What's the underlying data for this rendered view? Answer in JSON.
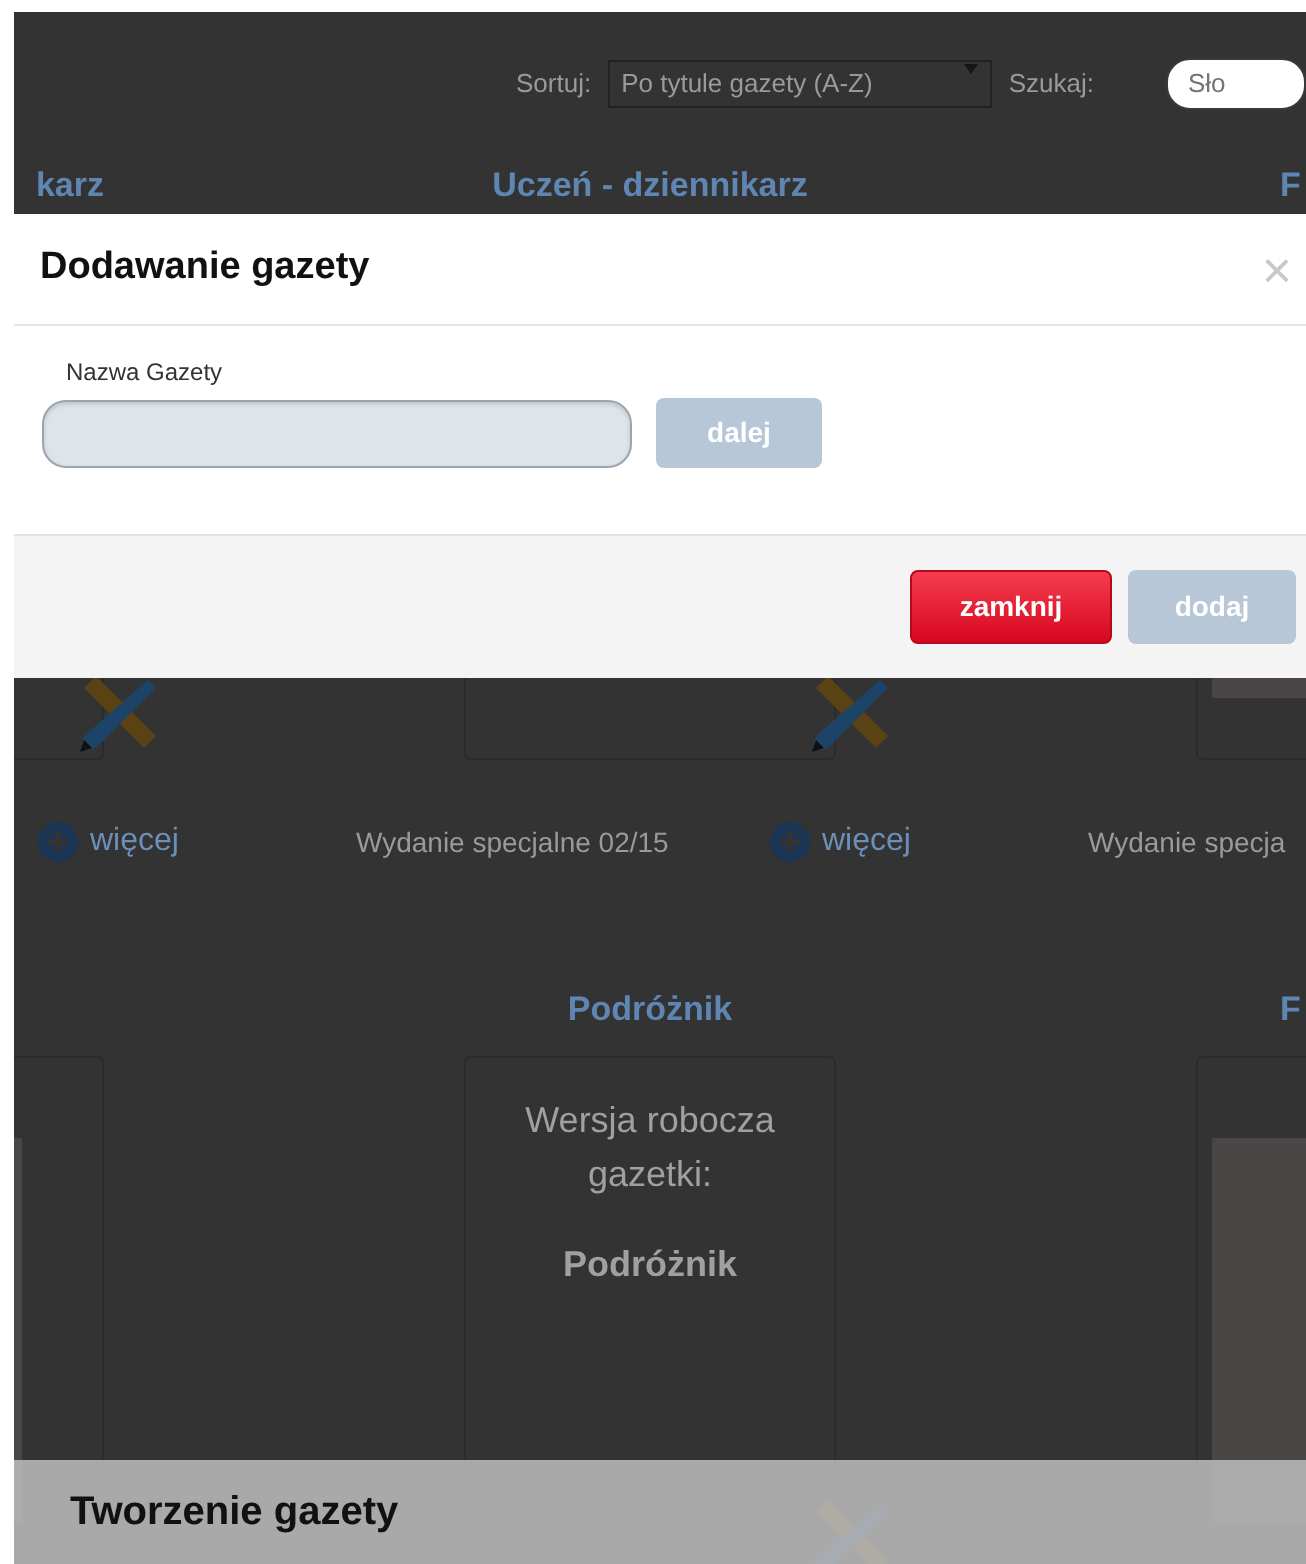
{
  "toolbar": {
    "sort_label": "Sortuj:",
    "sort_value": "Po tytule gazety (A-Z)",
    "search_label": "Szukaj:",
    "search_placeholder": "Sło"
  },
  "rows": [
    {
      "columns": [
        {
          "heading": "karz",
          "card": {
            "kind": "blank",
            "edit_icon": true
          },
          "footer": {
            "more": "więcej"
          }
        },
        {
          "heading": "Uczeń - dziennikarz",
          "card": {
            "kind": "blank",
            "edit_icon": true
          },
          "footer": {
            "title": "Wydanie specjalne 02/15",
            "more": "więcej"
          }
        },
        {
          "heading": "F",
          "card": {
            "kind": "thumbnail",
            "edit_icon": false
          },
          "footer": {
            "title": "Wydanie specja"
          }
        }
      ]
    },
    {
      "columns": [
        {
          "card": {
            "kind": "thumbnail",
            "edit_icon": false
          }
        },
        {
          "heading": "Podróżnik",
          "card": {
            "kind": "draft",
            "text": "Wersja robocza gazetki:",
            "name": "Podróżnik",
            "edit_icon": true
          }
        },
        {
          "heading": "F",
          "card": {
            "kind": "thumbnail",
            "edit_icon": false
          }
        }
      ]
    }
  ],
  "modal": {
    "title": "Dodawanie gazety",
    "close": "×",
    "field_label": "Nazwa Gazety",
    "next_button": {
      "label": "dalej",
      "kind": "primary",
      "disabled": true
    },
    "footer_buttons": [
      {
        "label": "zamknij",
        "kind": "danger",
        "disabled": false
      },
      {
        "label": "dodaj",
        "kind": "primary",
        "disabled": true
      }
    ]
  },
  "caption": "Tworzenie gazety"
}
